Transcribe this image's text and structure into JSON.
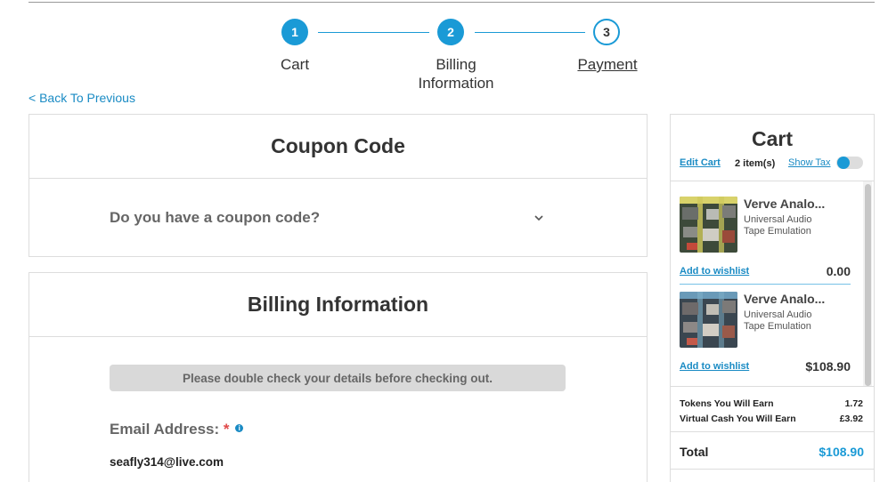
{
  "stepper": {
    "steps": [
      {
        "number": "1",
        "label": "Cart",
        "state": "done"
      },
      {
        "number": "2",
        "label_line1": "Billing",
        "label_line2": "Information",
        "state": "done"
      },
      {
        "number": "3",
        "label": "Payment",
        "state": "current"
      }
    ]
  },
  "back_link": "< Back To Previous",
  "coupon": {
    "title": "Coupon Code",
    "question": "Do you have a coupon code?",
    "toggle_icon": "chevron-down-icon"
  },
  "billing": {
    "title": "Billing Information",
    "notice": "Please double check your details before checking out.",
    "email_label": "Email Address:",
    "required_mark": "*",
    "info_icon_text": "i",
    "email_value": "seafly314@live.com"
  },
  "cart": {
    "title": "Cart",
    "edit_label": "Edit Cart",
    "item_count": "2 item(s)",
    "show_tax_label": "Show Tax",
    "show_tax_on": false,
    "items": [
      {
        "name": "Verve Analo...",
        "vendor": "Universal Audio",
        "category": "Tape Emulation",
        "wishlist": "Add to wishlist",
        "price": "0.00"
      },
      {
        "name": "Verve Analo...",
        "vendor": "Universal Audio",
        "category": "Tape Emulation",
        "wishlist": "Add to wishlist",
        "price": "$108.90"
      }
    ],
    "tokens_label": "Tokens You Will Earn",
    "tokens_value": "1.72",
    "cash_label": "Virtual Cash You Will Earn",
    "cash_value": "£3.92",
    "total_label": "Total",
    "total_value": "$108.90"
  },
  "colors": {
    "accent": "#1a9ad6",
    "link": "#1a8bc4",
    "required": "#e04a4a",
    "notice_bg": "#d9d9d9"
  }
}
